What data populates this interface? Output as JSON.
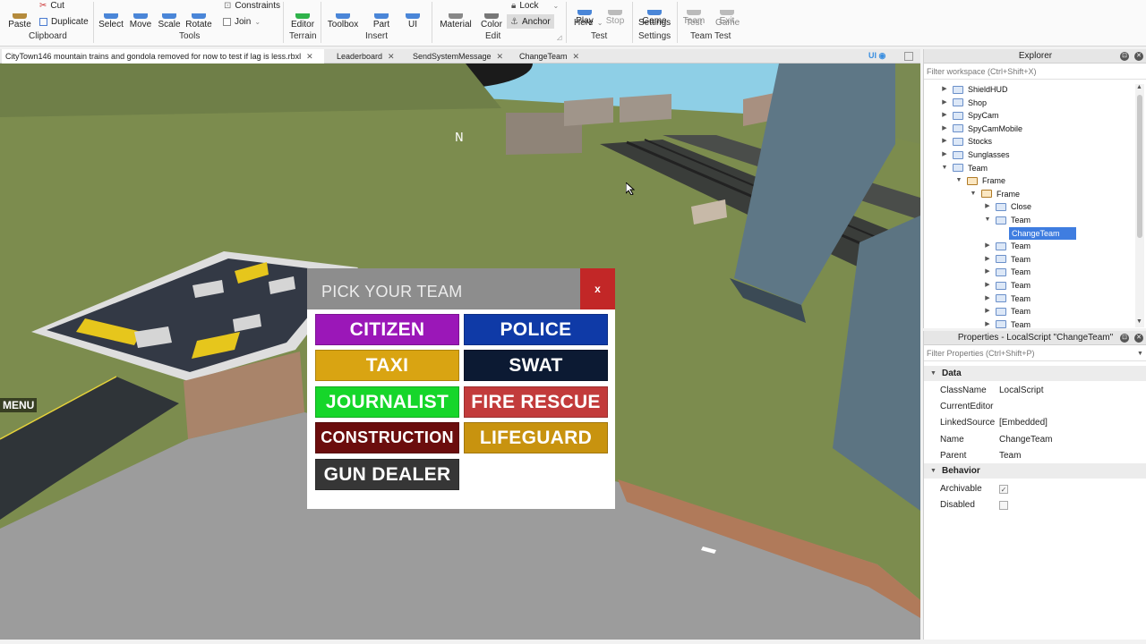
{
  "ribbon": {
    "clipboard": {
      "paste": "Paste",
      "cut": "Cut",
      "duplicate": "Duplicate",
      "group": "Clipboard"
    },
    "tools": {
      "select": "Select",
      "move": "Move",
      "scale": "Scale",
      "rotate": "Rotate",
      "constraints": "Constraints",
      "join": "Join",
      "group": "Tools"
    },
    "terrain": {
      "editor": "Editor",
      "group": "Terrain"
    },
    "insert": {
      "toolbox": "Toolbox",
      "part": "Part",
      "ui": "UI",
      "group": "Insert"
    },
    "edit": {
      "material": "Material",
      "color": "Color",
      "lock": "Lock",
      "anchor": "Anchor",
      "group": "Edit"
    },
    "test": {
      "play_here_1": "Play",
      "play_here_2": "Here",
      "stop": "Stop",
      "group": "Test"
    },
    "settings": {
      "game_settings_1": "Game",
      "game_settings_2": "Settings",
      "group": "Settings"
    },
    "team_test": {
      "team_test_1": "Team",
      "team_test_2": "Test",
      "exit_game_1": "Exit",
      "exit_game_2": "Game",
      "group": "Team Test"
    }
  },
  "tabs": [
    {
      "label": "CityTown146 mountain trains and gondola removed for now to test if lag is less.rbxl"
    },
    {
      "label": "Leaderboard"
    },
    {
      "label": "SendSystemMessage"
    },
    {
      "label": "ChangeTeam"
    }
  ],
  "viewport": {
    "ui_toggle": "UI",
    "compass": "N",
    "menu": "MENU"
  },
  "team_gui": {
    "title": "PICK YOUR TEAM",
    "close": "x",
    "teams": [
      {
        "label": "CITIZEN",
        "color": "#9b17b8"
      },
      {
        "label": "POLICE",
        "color": "#0f3aa7"
      },
      {
        "label": "TAXI",
        "color": "#d9a412"
      },
      {
        "label": "SWAT",
        "color": "#0c1a33"
      },
      {
        "label": "JOURNALIST",
        "color": "#16d62a"
      },
      {
        "label": "FIRE RESCUE",
        "color": "#c23b3b"
      },
      {
        "label": "CONSTRUCTION",
        "color": "#6b0d0d"
      },
      {
        "label": "LIFEGUARD",
        "color": "#c8930f"
      },
      {
        "label": "GUN DEALER",
        "color": "#363636"
      }
    ]
  },
  "explorer": {
    "title": "Explorer",
    "filter": "Filter workspace (Ctrl+Shift+X)",
    "items": [
      {
        "label": "ShieldHUD",
        "arrow": "▶",
        "icon": "gui"
      },
      {
        "label": "Shop",
        "arrow": "▶",
        "icon": "gui"
      },
      {
        "label": "SpyCam",
        "arrow": "▶",
        "icon": "gui"
      },
      {
        "label": "SpyCamMobile",
        "arrow": "▶",
        "icon": "gui"
      },
      {
        "label": "Stocks",
        "arrow": "▶",
        "icon": "gui"
      },
      {
        "label": "Sunglasses",
        "arrow": "▶",
        "icon": "gui"
      },
      {
        "label": "Team",
        "arrow": "▼",
        "icon": "gui"
      },
      {
        "label": "Frame",
        "arrow": "▼",
        "icon": "frame"
      },
      {
        "label": "Frame",
        "arrow": "▼",
        "icon": "frame"
      },
      {
        "label": "Close",
        "arrow": "▶",
        "icon": "gui"
      },
      {
        "label": "Team",
        "arrow": "▼",
        "icon": "gui"
      },
      {
        "label": "ChangeTeam",
        "arrow": "",
        "icon": ""
      },
      {
        "label": "Team",
        "arrow": "▶",
        "icon": "gui"
      },
      {
        "label": "Team",
        "arrow": "▶",
        "icon": "gui"
      },
      {
        "label": "Team",
        "arrow": "▶",
        "icon": "gui"
      },
      {
        "label": "Team",
        "arrow": "▶",
        "icon": "gui"
      },
      {
        "label": "Team",
        "arrow": "▶",
        "icon": "gui"
      },
      {
        "label": "Team",
        "arrow": "▶",
        "icon": "gui"
      },
      {
        "label": "Team",
        "arrow": "▶",
        "icon": "gui"
      }
    ]
  },
  "properties": {
    "title": "Properties - LocalScript \"ChangeTeam\"",
    "filter": "Filter Properties (Ctrl+Shift+P)",
    "data_category": "Data",
    "behavior_category": "Behavior",
    "rows": [
      {
        "key": "ClassName",
        "value": "LocalScript"
      },
      {
        "key": "CurrentEditor",
        "value": ""
      },
      {
        "key": "LinkedSource",
        "value": "[Embedded]"
      },
      {
        "key": "Name",
        "value": "ChangeTeam"
      },
      {
        "key": "Parent",
        "value": "Team"
      }
    ],
    "behavior_rows": [
      {
        "key": "Archivable",
        "checked": true
      },
      {
        "key": "Disabled",
        "checked": false
      }
    ]
  }
}
